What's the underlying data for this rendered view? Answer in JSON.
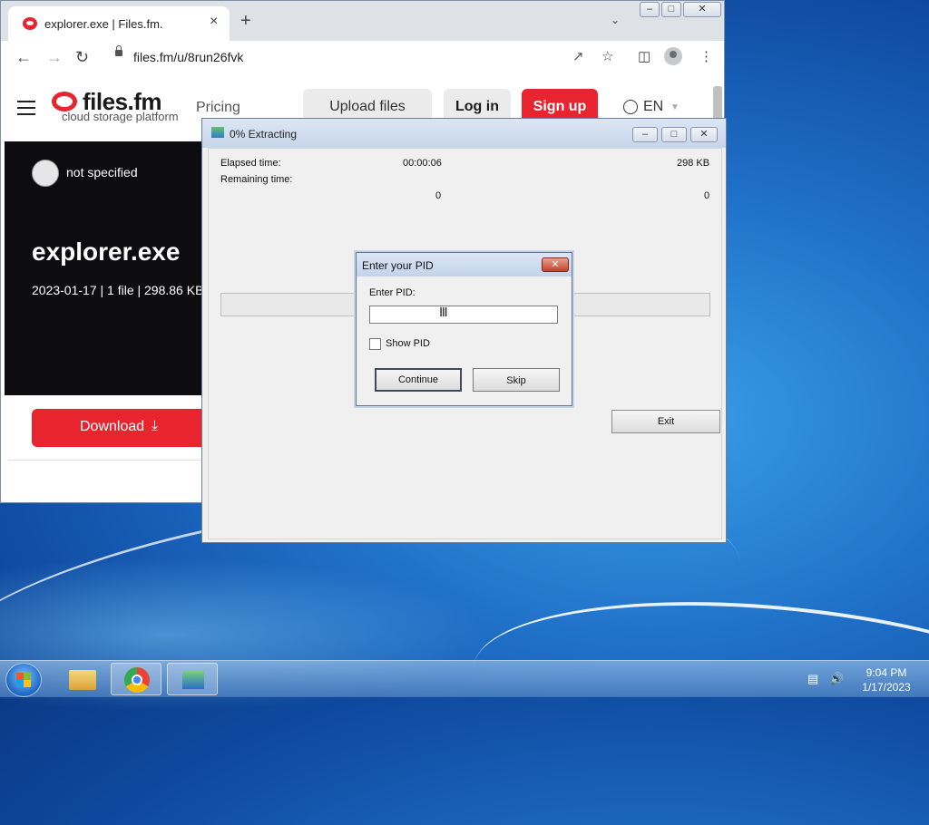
{
  "browser": {
    "tab_title": "explorer.exe | Files.fm.",
    "tab_close": "×",
    "new_tab": "+",
    "url": "files.fm/u/8run26fvk"
  },
  "site": {
    "logo": "files.fm",
    "logo_tagline": "cloud storage platform",
    "nav": {
      "pricing": "Pricing",
      "upload": "Upload files",
      "login": "Log in",
      "signup": "Sign up",
      "language": "EN"
    },
    "owner": "not specified",
    "file_name": "explorer.exe",
    "file_meta": "2023-01-17 | 1 file | 298.86 KB",
    "download": "Download",
    "brand_color": "#e8242f"
  },
  "extractor": {
    "title": "0% Extracting",
    "elapsed_label": "Elapsed time:",
    "elapsed_value": "00:00:06",
    "size_value": "298 KB",
    "remaining_label": "Remaining time:",
    "count_left": "0",
    "count_right": "0",
    "progress_percent": 0,
    "exit": "Exit"
  },
  "pid_dialog": {
    "title": "Enter your PID",
    "close": "✕",
    "field_label": "Enter PID:",
    "field_value": "",
    "show_pid_label": "Show PID",
    "show_pid_checked": false,
    "continue": "Continue",
    "skip": "Skip"
  },
  "taskbar": {
    "time": "9:04 PM",
    "date": "1/17/2023"
  }
}
